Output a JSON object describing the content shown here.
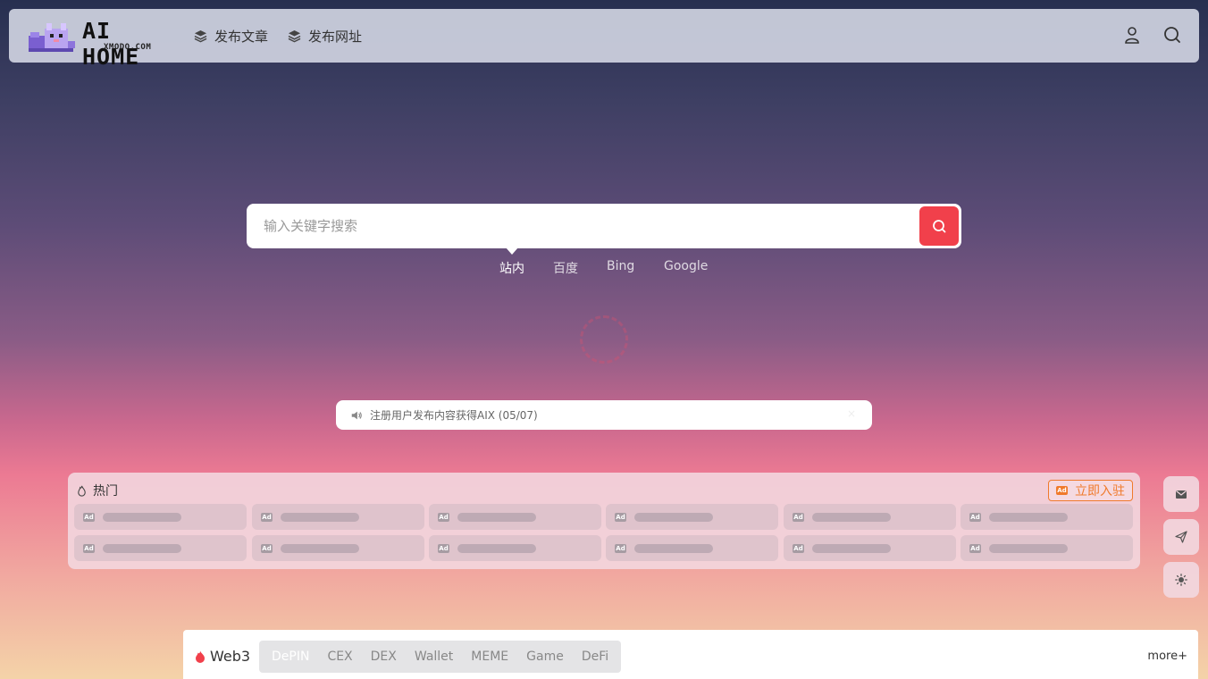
{
  "header": {
    "brand": "AI HOME",
    "brand_sub": "XMODO.COM",
    "nav": [
      {
        "label": "发布文章"
      },
      {
        "label": "发布网址"
      }
    ]
  },
  "search": {
    "placeholder": "输入关键字搜索",
    "engines": [
      "站内",
      "百度",
      "Bing",
      "Google"
    ],
    "active_engine": "站内"
  },
  "notice": {
    "text": "注册用户发布内容获得AIX (05/07)",
    "close": "×"
  },
  "hot": {
    "title": "热门",
    "join_label": "立即入驻",
    "ad_badge": "Ad"
  },
  "web3": {
    "title": "Web3",
    "tabs": [
      "DePIN",
      "CEX",
      "DEX",
      "Wallet",
      "MEME",
      "Game",
      "DeFi"
    ],
    "active_tab": "DePIN",
    "more": "more+"
  },
  "colors": {
    "accent": "#f1404b",
    "join": "#f07a2c"
  },
  "icons": {
    "nav": "layers-icon",
    "user": "user-icon",
    "search": "search-icon",
    "notice": "speaker-icon",
    "hot": "fire-icon",
    "side": [
      "mail-icon",
      "send-icon",
      "sun-icon"
    ]
  }
}
